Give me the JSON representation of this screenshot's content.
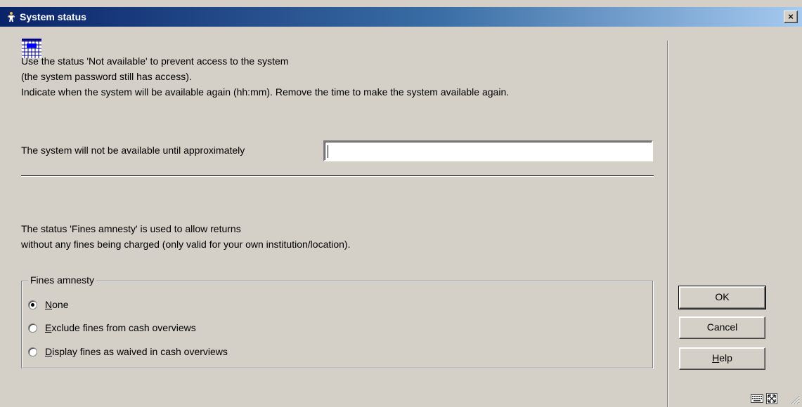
{
  "window": {
    "title": "System status",
    "close_label": "×"
  },
  "intro": {
    "line1": "Use the status 'Not available' to prevent access to the system",
    "line2": "(the system password still has access).",
    "line3": "Indicate when the system will be available again (hh:mm).  Remove the time to make the system available again."
  },
  "until": {
    "label": "The system will not be available until approximately",
    "value": ""
  },
  "amnesty_info": {
    "line1": "The status 'Fines amnesty' is used to allow returns",
    "line2": "without any fines being charged (only valid for your own institution/location)."
  },
  "fines_amnesty": {
    "legend": "Fines amnesty",
    "options": [
      {
        "mnemonic": "N",
        "rest": "one",
        "selected": true
      },
      {
        "mnemonic": "E",
        "rest": "xclude fines from cash overviews",
        "selected": false
      },
      {
        "mnemonic": "D",
        "rest": "isplay fines as waived in cash overviews",
        "selected": false
      }
    ]
  },
  "buttons": {
    "ok": "OK",
    "cancel": "Cancel",
    "help_mnemonic": "H",
    "help_rest": "elp"
  },
  "icons": {
    "title": "person-icon",
    "app": "grid-icon",
    "tray1": "keyboard-icon",
    "tray2": "maximize-icon",
    "grip": "resize-grip-icon"
  },
  "colors": {
    "titlebar": "#0a246a",
    "face": "#d4d0c8"
  }
}
